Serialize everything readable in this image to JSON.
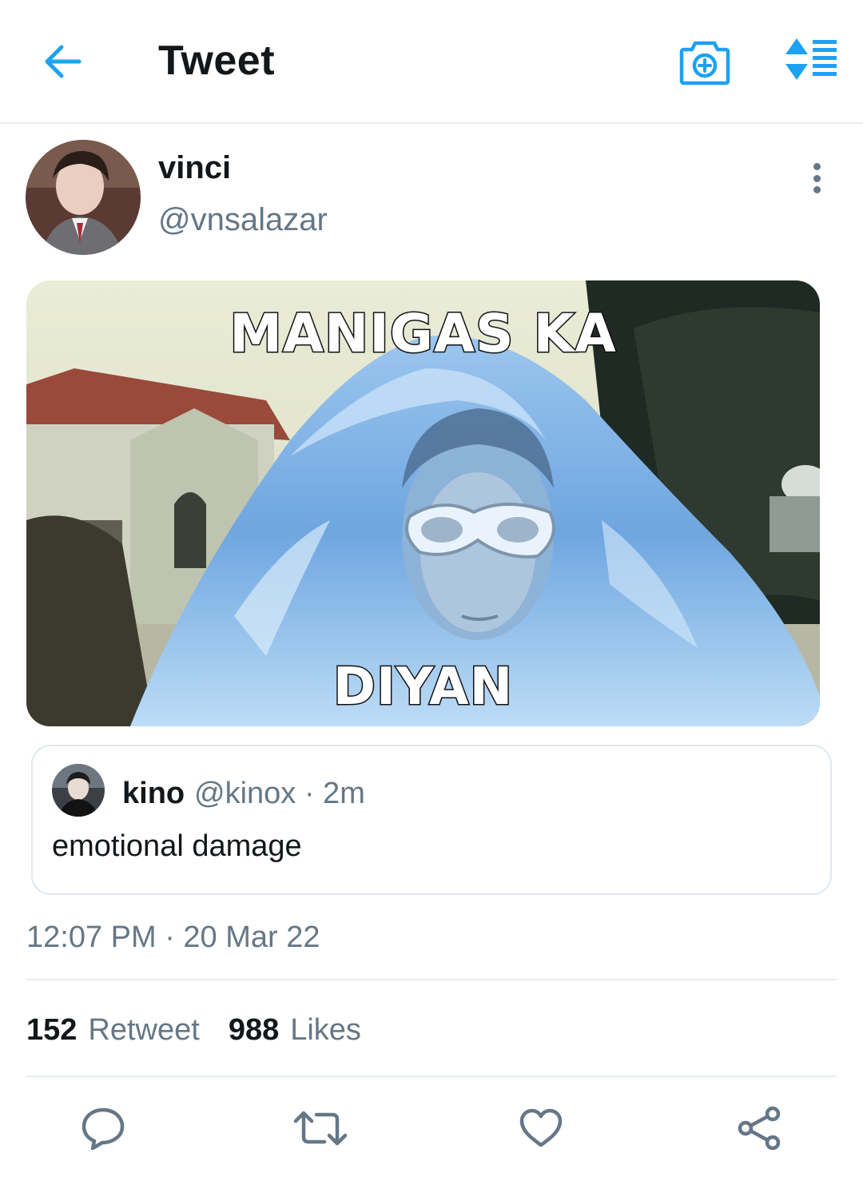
{
  "header": {
    "title": "Tweet",
    "back_icon": "arrow-left-icon",
    "camera_icon": "camera-plus-icon",
    "sort_icon": "sparkle-sort-icon",
    "accent_color": "#1da1f2"
  },
  "tweet": {
    "author": {
      "name": "vinci",
      "handle": "@vnsalazar"
    },
    "media": {
      "top_text": "MANIGAS KA",
      "bottom_text": "DIYAN"
    },
    "quoted": {
      "name": "kino",
      "handle_time": "@kinox · 2m",
      "text": "emotional damage"
    },
    "timestamp": "12:07 PM · 20 Mar 22",
    "stats": {
      "retweet_count": "152",
      "retweet_label": "Retweet",
      "like_count": "988",
      "like_label": "Likes"
    },
    "actions": [
      "reply-icon",
      "retweet-icon",
      "like-icon",
      "share-icon"
    ]
  }
}
